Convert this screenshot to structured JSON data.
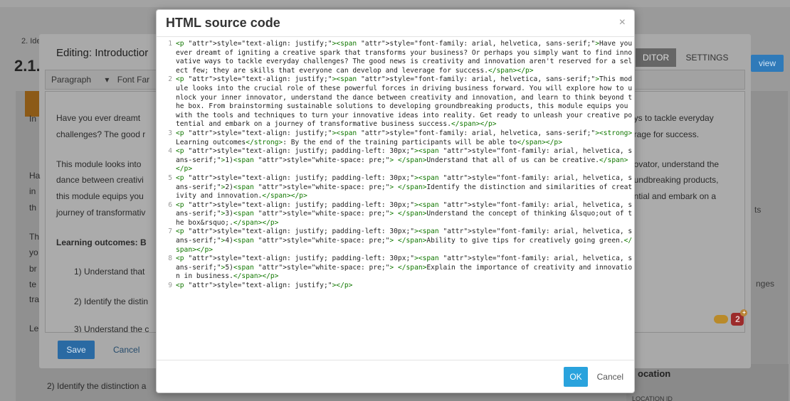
{
  "background": {
    "breadcrumb": "2. Idea",
    "heading": "2.1.",
    "view_button": "view",
    "right_texts": [
      "ts",
      "nges"
    ],
    "location_title": "ocation",
    "location_sub": "LOCATION ID",
    "bottom_text": "2) Identify the distinction a"
  },
  "editor_dialog": {
    "title": "Editing: Introductior",
    "tabs": [
      "DITOR",
      "SETTINGS"
    ],
    "toolbar": {
      "format": "Paragraph",
      "font": "Font Far"
    },
    "content_left": [
      "Have you ever dreamt",
      "challenges? The good r",
      "This module looks into",
      "dance between creativi",
      "this module equips you",
      "journey of transformativ",
      "Learning outcomes: B",
      "1) Understand that",
      "2) Identify the distin",
      "3) Understand the c"
    ],
    "content_right": [
      "ays to tackle everyday",
      "erage for success.",
      "novator, understand the",
      "oundbreaking products,",
      "ential and embark on a"
    ],
    "side_letters": [
      "In",
      "Ha",
      "in",
      "th",
      "Th",
      "yo",
      "br",
      "te",
      "tra",
      "Le"
    ],
    "save_label": "Save",
    "cancel_label": "Cancel",
    "badge_number": "2",
    "badge_plus": "+"
  },
  "source_modal": {
    "title": "HTML source code",
    "close": "×",
    "ok_label": "OK",
    "cancel_label": "Cancel",
    "lines": [
      {
        "num": "1",
        "text": "<p style=\"text-align: justify;\"><span style=\"font-family: arial, helvetica, sans-serif;\">Have you ever dreamt of igniting a creative spark that transforms your business? Or perhaps you simply want to find innovative ways to tackle everyday challenges? The good news is creativity and innovation aren't reserved for a select few; they are skills that everyone can develop and leverage for success.</span></p>"
      },
      {
        "num": "2",
        "text": "<p style=\"text-align: justify;\"><span style=\"font-family: arial, helvetica, sans-serif;\">This module looks into the crucial role of these powerful forces in driving business forward. You will explore how to unlock your inner innovator, understand the dance between creativity and innovation, and learn to think beyond the box. From brainstorming sustainable solutions to developing groundbreaking products, this module equips you with the tools and techniques to turn your innovative ideas into reality. Get ready to unleash your creative potential and embark on a journey of transformative business success.</span></p>"
      },
      {
        "num": "3",
        "text": "<p style=\"text-align: justify;\"><span style=\"font-family: arial, helvetica, sans-serif;\"><strong>Learning outcomes</strong>: By the end of the training participants will be able to</span></p>"
      },
      {
        "num": "4",
        "text": "<p style=\"text-align: justify; padding-left: 30px;\"><span style=\"font-family: arial, helvetica, sans-serif;\">1)<span style=\"white-space: pre;\"> </span>Understand that all of us can be creative.</span></p>"
      },
      {
        "num": "5",
        "text": "<p style=\"text-align: justify; padding-left: 30px;\"><span style=\"font-family: arial, helvetica, sans-serif;\">2)<span style=\"white-space: pre;\"> </span>Identify the distinction and similarities of creativity and innovation.</span></p>"
      },
      {
        "num": "6",
        "text": "<p style=\"text-align: justify; padding-left: 30px;\"><span style=\"font-family: arial, helvetica, sans-serif;\">3)<span style=\"white-space: pre;\"> </span>Understand the concept of thinking &lsquo;out of the box&rsquo;.</span></p>"
      },
      {
        "num": "7",
        "text": "<p style=\"text-align: justify; padding-left: 30px;\"><span style=\"font-family: arial, helvetica, sans-serif;\">4)<span style=\"white-space: pre;\"> </span>Ability to give tips for creatively going green.</span></p>"
      },
      {
        "num": "8",
        "text": "<p style=\"text-align: justify; padding-left: 30px;\"><span style=\"font-family: arial, helvetica, sans-serif;\">5)<span style=\"white-space: pre;\"> </span>Explain the importance of creativity and innovation in business.</span></p>"
      },
      {
        "num": "9",
        "text": "<p style=\"text-align: justify;\"></p>"
      }
    ]
  }
}
